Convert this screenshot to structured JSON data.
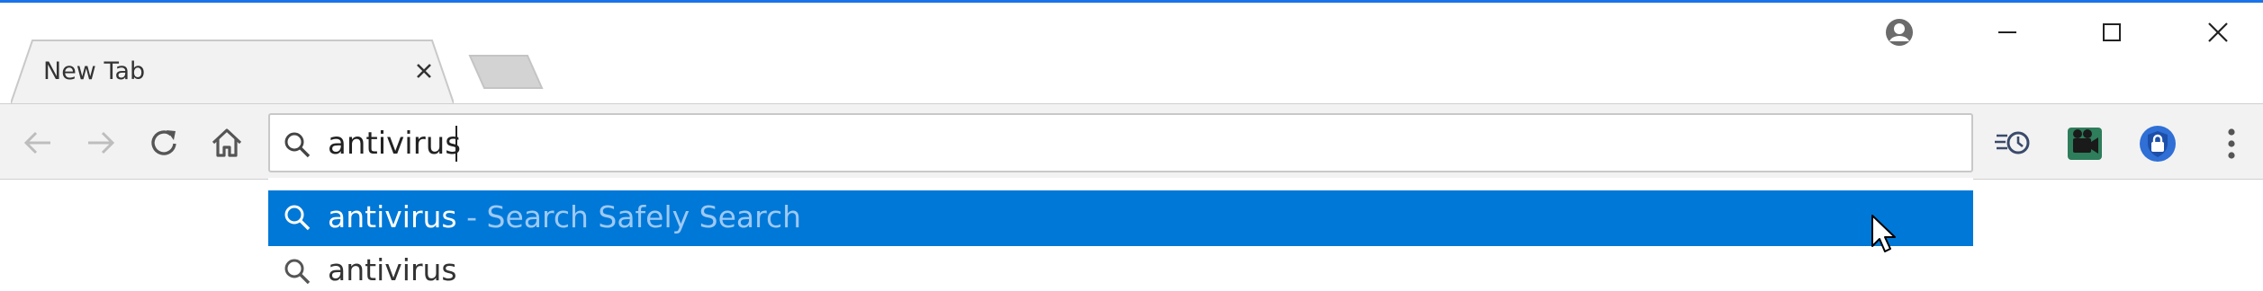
{
  "tab": {
    "title": "New Tab"
  },
  "omnibox": {
    "value": "antivirus"
  },
  "suggestions": [
    {
      "query": "antivirus",
      "separator": " - ",
      "source": "Search Safely Search"
    },
    {
      "query": "antivirus"
    }
  ],
  "icons": {
    "window": [
      "profile-icon",
      "minimize-icon",
      "maximize-icon",
      "close-icon"
    ],
    "nav": [
      "back-arrow-icon",
      "forward-arrow-icon",
      "reload-icon",
      "home-icon"
    ],
    "extensions": [
      "history-speed-icon",
      "video-extension-icon",
      "lock-shield-icon",
      "more-menu-icon"
    ]
  },
  "colors": {
    "accent": "#1a73e8",
    "selection": "#0078d7",
    "toolbar_bg": "#f2f2f2",
    "suggestion_source": "#9cc9f5"
  }
}
